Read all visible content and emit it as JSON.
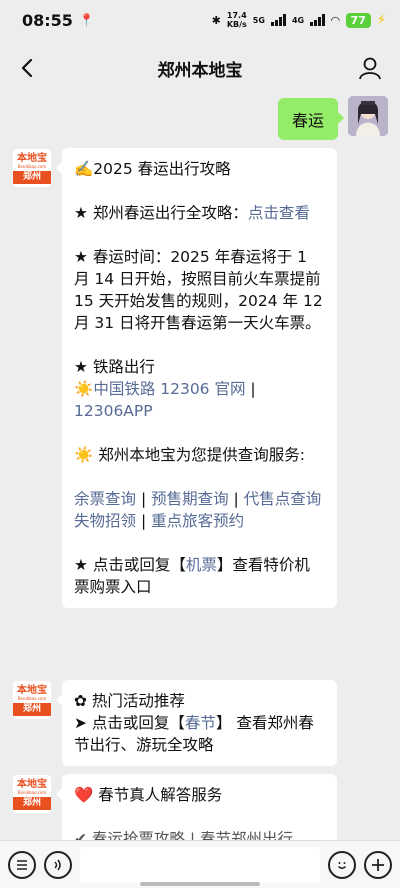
{
  "status": {
    "time": "08:55",
    "net_speed": "17.4",
    "net_unit": "KB/s",
    "sig1": "5G",
    "sig2": "4G",
    "battery": "77"
  },
  "nav": {
    "title": "郑州本地宝"
  },
  "outgoing": {
    "text": "春运"
  },
  "logo": {
    "line1": "本地宝",
    "line2": "Bendibao.com",
    "city": "郑州"
  },
  "msg1": {
    "title": "✍️2025 春运出行攻略",
    "guide_prefix": "★ 郑州春运出行全攻略：",
    "guide_link": "点击查看",
    "time_text": "★ 春运时间：2025 年春运将于 1 月 14 日开始，按照目前火车票提前15 天开始发售的规则，2024 年 12 月 31 日将开售春运第一天火车票。",
    "rail_title": "★ 铁路出行",
    "rail_sun": "☀️",
    "rail_link1": "中国铁路 12306 官网",
    "rail_sep": " | ",
    "rail_link2": "12306APP",
    "service_title": "☀️ 郑州本地宝为您提供查询服务:",
    "svc_links": [
      "余票查询",
      "预售期查询",
      "代售点查询",
      "失物招领",
      "重点旅客预约"
    ],
    "sep": " | ",
    "air_prefix": "★ 点击或回复【",
    "air_link": "机票",
    "air_suffix": "】查看特价机票购票入口"
  },
  "msg2": {
    "title": "✿ 热门活动推荐",
    "line_prefix": "➤ 点击或回复【",
    "line_link": "春节",
    "line_suffix": "】 查看郑州春节出行、游玩全攻略"
  },
  "msg3": {
    "title": "❤️ 春节真人解答服务",
    "partial": "✔ 春运抢票攻略 | 春节郑州出行"
  }
}
